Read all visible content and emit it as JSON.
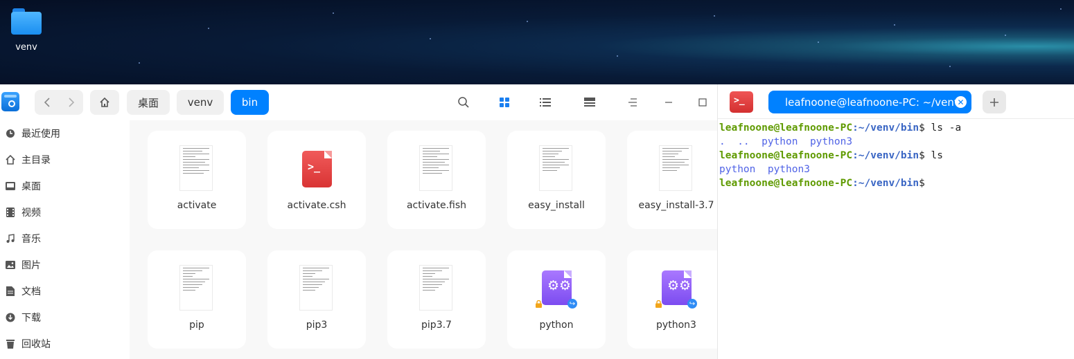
{
  "desktop": {
    "icons": [
      {
        "label": "venv"
      }
    ]
  },
  "file_manager": {
    "breadcrumbs": [
      "桌面",
      "venv",
      "bin"
    ],
    "sidebar": {
      "items": [
        {
          "label": "最近使用",
          "icon": "clock-icon"
        },
        {
          "label": "主目录",
          "icon": "home-icon"
        },
        {
          "label": "桌面",
          "icon": "desktop-icon"
        },
        {
          "label": "视频",
          "icon": "video-icon"
        },
        {
          "label": "音乐",
          "icon": "music-icon"
        },
        {
          "label": "图片",
          "icon": "picture-icon"
        },
        {
          "label": "文档",
          "icon": "document-icon"
        },
        {
          "label": "下载",
          "icon": "download-icon"
        },
        {
          "label": "回收站",
          "icon": "trash-icon"
        }
      ]
    },
    "files": [
      {
        "name": "activate",
        "type": "text"
      },
      {
        "name": "activate.csh",
        "type": "terminal-script"
      },
      {
        "name": "activate.fish",
        "type": "text"
      },
      {
        "name": "easy_install",
        "type": "text"
      },
      {
        "name": "easy_install-3.7",
        "type": "text"
      },
      {
        "name": "pip",
        "type": "text"
      },
      {
        "name": "pip3",
        "type": "text"
      },
      {
        "name": "pip3.7",
        "type": "text"
      },
      {
        "name": "python",
        "type": "executable-link"
      },
      {
        "name": "python3",
        "type": "executable-link"
      }
    ]
  },
  "terminal": {
    "tab_title": "leafnoone@leafnoone-PC: ~/venv/bin",
    "prompt_user": "leafnoone@leafnoone-PC",
    "prompt_path": ":~/venv/bin",
    "prompt_symbol": "$",
    "cmd1": " ls -a",
    "out1": ".  ..  python  python3",
    "cmd2": " ls",
    "out2": "python  python3",
    "cmd3": ""
  }
}
